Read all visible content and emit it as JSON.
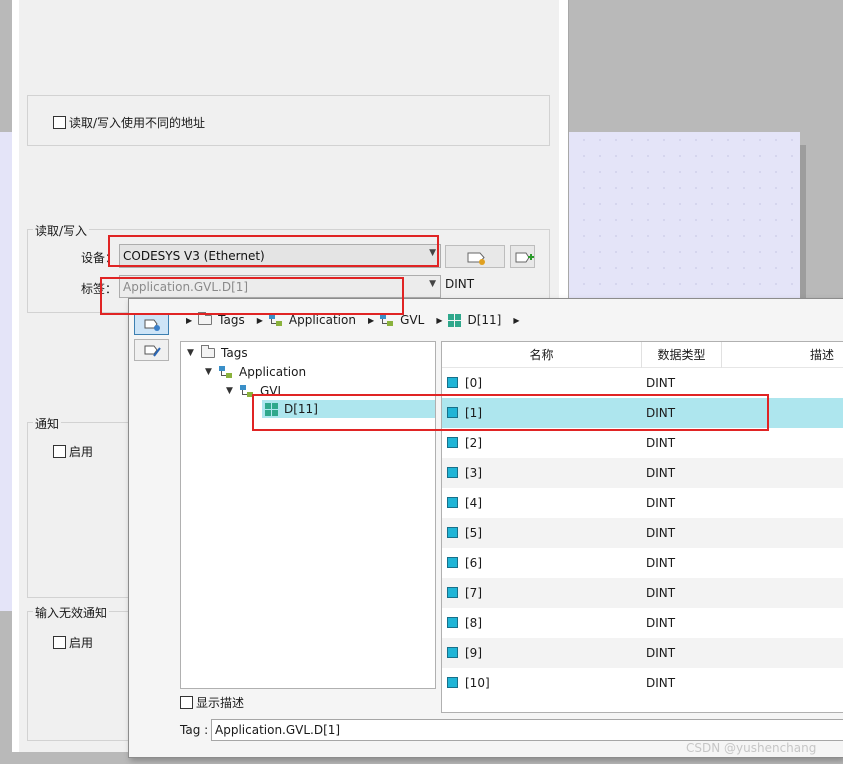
{
  "rw_section": {
    "diff_address_label": "读取/写入使用不同的地址",
    "title": "读取/写入",
    "device_label": "设备：",
    "device_value": "CODESYS V3 (Ethernet)",
    "tag_label": "标签：",
    "tag_value": "Application.GVL.D[1]",
    "type_value": "DINT"
  },
  "notify_section": {
    "title": "通知",
    "enable_label": "启用"
  },
  "invalid_section": {
    "title": "输入无效通知",
    "enable_label": "启用"
  },
  "popup": {
    "breadcrumb": [
      "Tags",
      "Application",
      "GVL",
      "D[11]"
    ],
    "tree": {
      "root": "Tags",
      "application": "Application",
      "gvl": "GVL",
      "selected": "D[11]"
    },
    "columns": {
      "name": "名称",
      "type": "数据类型",
      "desc": "描述"
    },
    "rows": [
      {
        "name": "[0]",
        "type": "DINT"
      },
      {
        "name": "[1]",
        "type": "DINT"
      },
      {
        "name": "[2]",
        "type": "DINT"
      },
      {
        "name": "[3]",
        "type": "DINT"
      },
      {
        "name": "[4]",
        "type": "DINT"
      },
      {
        "name": "[5]",
        "type": "DINT"
      },
      {
        "name": "[6]",
        "type": "DINT"
      },
      {
        "name": "[7]",
        "type": "DINT"
      },
      {
        "name": "[8]",
        "type": "DINT"
      },
      {
        "name": "[9]",
        "type": "DINT"
      },
      {
        "name": "[10]",
        "type": "DINT"
      }
    ],
    "selected_row": "[1]",
    "show_desc_label": "显示描述",
    "tag_field_label": "Tag :",
    "tag_field_value": "Application.GVL.D[1]"
  },
  "watermark": "CSDN @yushenchang",
  "colors": {
    "highlight": "#e02424",
    "selection": "#aee6ee",
    "element_icon": "#1fb4d6"
  }
}
